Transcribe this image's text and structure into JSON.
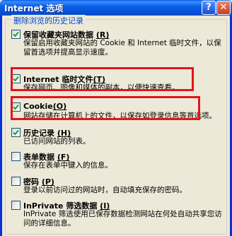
{
  "window": {
    "title": "Internet 选项",
    "help_glyph": "?",
    "close_glyph": "✕"
  },
  "group": {
    "title": "删除浏览的历史记录"
  },
  "items": [
    {
      "label": "保留收藏夹网站数据",
      "hotkey": "(R)",
      "checked": true,
      "desc": "保留启用收藏夹网站的 Cookie 和 Internet 临时文件，以保留首选项并提高显示速度。"
    },
    {
      "label": "Internet 临时文件",
      "hotkey": "(T)",
      "checked": true,
      "desc": "保存网页、图像和媒体的副本，以便快速查看。"
    },
    {
      "label": "Cookie",
      "hotkey": "(O)",
      "checked": true,
      "desc": "网站存储在计算机上的文件，以保存如登录信息等首选项。"
    },
    {
      "label": "历史记录",
      "hotkey": "(H)",
      "checked": true,
      "desc": "已访问网站的列表。"
    },
    {
      "label": "表单数据",
      "hotkey": "(F)",
      "checked": false,
      "desc": "保存在表单中键入的信息。"
    },
    {
      "label": "密码",
      "hotkey": "(P)",
      "checked": false,
      "desc": "登录以前访问过的网站时，自动填充保存的密码。"
    },
    {
      "label": "InPrivate 筛选数据",
      "hotkey": "(I)",
      "checked": false,
      "desc": "InPrivate 筛选使用已保存数据检测网站在何处自动共享您访问的详细信息。"
    }
  ],
  "colors": {
    "titlebar": "#0b5fe6",
    "group_title": "#0046d5",
    "highlight": "#e0161b",
    "dialog_bg": "#ece9d8"
  }
}
